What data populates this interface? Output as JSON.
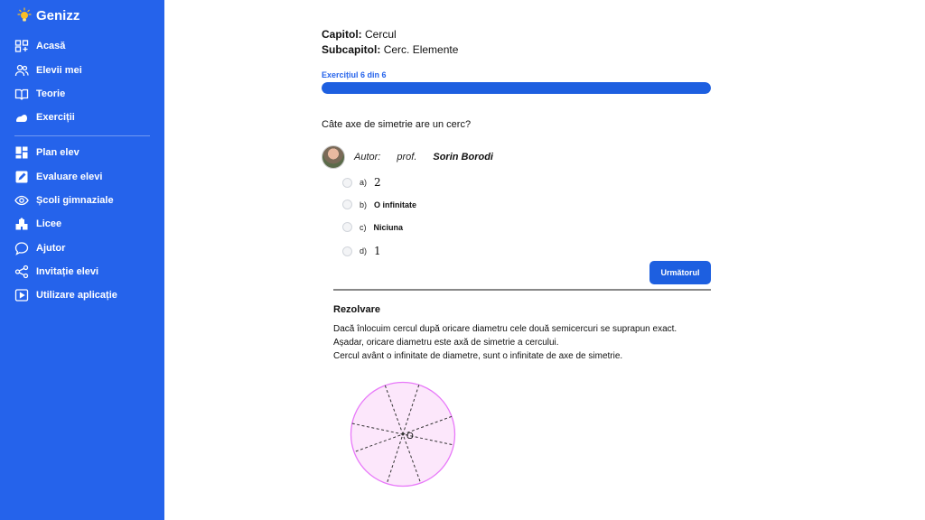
{
  "app": {
    "name": "Genizz"
  },
  "sidebar": {
    "items": [
      {
        "label": "Acasă",
        "icon": "home-icon"
      },
      {
        "label": "Elevii mei",
        "icon": "users-icon"
      },
      {
        "label": "Teorie",
        "icon": "book-icon"
      },
      {
        "label": "Exerciții",
        "icon": "exercise-icon"
      },
      {
        "label": "Plan elev",
        "icon": "dashboard-icon"
      },
      {
        "label": "Evaluare elevi",
        "icon": "edit-icon"
      },
      {
        "label": "Școli gimnaziale",
        "icon": "eye-icon"
      },
      {
        "label": "Licee",
        "icon": "school-icon"
      },
      {
        "label": "Ajutor",
        "icon": "chat-icon"
      },
      {
        "label": "Invitație elevi",
        "icon": "share-icon"
      },
      {
        "label": "Utilizare aplicație",
        "icon": "play-icon"
      }
    ]
  },
  "header": {
    "chapter_label": "Capitol:",
    "chapter_value": "Cercul",
    "subchapter_label": "Subcapitol:",
    "subchapter_value": "Cerc. Elemente"
  },
  "progress": {
    "label": "Exercițiul 6 din 6",
    "current": 6,
    "total": 6,
    "fraction": 1.0
  },
  "question": {
    "text": "Câte axe de simetrie are un cerc?",
    "author_label": "Autor:",
    "author_title": "prof.",
    "author_name": "Sorin Borodi",
    "options": [
      {
        "letter": "a)",
        "text": "2"
      },
      {
        "letter": "b)",
        "text": "O infinitate"
      },
      {
        "letter": "c)",
        "text": "Niciuna"
      },
      {
        "letter": "d)",
        "text": "1"
      }
    ],
    "next_label": "Următorul"
  },
  "solution": {
    "title": "Rezolvare",
    "lines": [
      "Dacă înlocuim cercul după oricare diametru cele două semicercuri se suprapun exact.",
      "Așadar, oricare diametru este axă de simetrie a cercului.",
      "Cercul avânt o infinitate de diametre, sunt o infinitate de axe de simetrie."
    ],
    "figure_center_label": "O"
  },
  "colors": {
    "sidebar": "#2563eb",
    "accent": "#1d5fe0",
    "circle_fill": "#fce7fb",
    "circle_stroke": "#e879f9"
  }
}
